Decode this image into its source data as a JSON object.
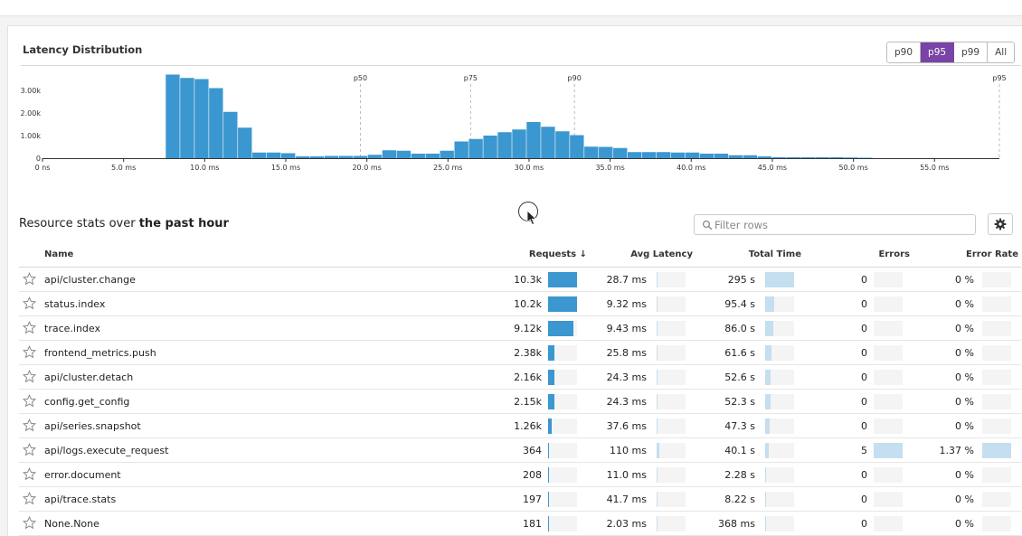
{
  "distribution": {
    "title": "Latency Distribution",
    "percentile_buttons": [
      {
        "label": "p90",
        "active": false
      },
      {
        "label": "p95",
        "active": true
      },
      {
        "label": "p99",
        "active": false
      },
      {
        "label": "All",
        "active": false
      }
    ]
  },
  "chart_data": {
    "type": "bar",
    "bin_width_ms": 0.89,
    "x": [
      7.6,
      8.5,
      9.4,
      10.3,
      11.2,
      12.1,
      13.0,
      13.9,
      14.8,
      15.7,
      16.6,
      17.5,
      18.4,
      19.3,
      20.2,
      21.1,
      22.0,
      22.9,
      23.8,
      24.7,
      25.6,
      26.5,
      27.4,
      28.3,
      29.2,
      30.1,
      31.0,
      31.9,
      32.8,
      33.7,
      34.6,
      35.5,
      36.4,
      37.3,
      38.2,
      39.1,
      40.0
    ],
    "values": [
      3700,
      3550,
      3500,
      3100,
      2050,
      1350,
      250,
      250,
      220,
      80,
      80,
      100,
      100,
      100,
      150,
      350,
      330,
      200,
      200,
      330,
      740,
      850,
      1000,
      1150,
      1270,
      1600,
      1390,
      1190,
      1020,
      510,
      500,
      450,
      270,
      270,
      270,
      250,
      250,
      200,
      200,
      130,
      130,
      80,
      40,
      40,
      40,
      40,
      40,
      30,
      20
    ],
    "xlabel": "",
    "ylabel": "",
    "xlim": [
      0,
      59
    ],
    "ylim": [
      0,
      4000
    ],
    "x_ticks": [
      "0 ns",
      "5.0 ms",
      "10.0 ms",
      "15.0 ms",
      "20.0 ms",
      "25.0 ms",
      "30.0 ms",
      "35.0 ms",
      "40.0 ms",
      "45.0 ms",
      "50.0 ms",
      "55.0 ms"
    ],
    "y_ticks": [
      "0",
      "1.00k",
      "2.00k",
      "3.00k"
    ],
    "markers": [
      {
        "label": "p50",
        "x": 19.6
      },
      {
        "label": "p75",
        "x": 26.4
      },
      {
        "label": "p90",
        "x": 32.8
      },
      {
        "label": "p95",
        "x": 59.0
      }
    ],
    "bar_color": "#3b97cf",
    "grid": false
  },
  "stats": {
    "title_prefix": "Resource stats over ",
    "title_emphasis": "the past hour",
    "filter_placeholder": "Filter rows",
    "columns": {
      "name": "Name",
      "requests": "Requests ↓",
      "avg_latency": "Avg Latency",
      "total_time": "Total Time",
      "errors": "Errors",
      "error_rate": "Error Rate"
    },
    "rows": [
      {
        "name": "api/cluster.change",
        "requests": "10.3k",
        "req_frac": 1.0,
        "avg_latency": "28.7 ms",
        "lat_frac": 0.02,
        "total_time": "295 s",
        "time_frac": 1.0,
        "errors": "0",
        "err_frac": 0,
        "error_rate": "0 %",
        "rate_frac": 0
      },
      {
        "name": "status.index",
        "requests": "10.2k",
        "req_frac": 0.99,
        "avg_latency": "9.32 ms",
        "lat_frac": 0.01,
        "total_time": "95.4 s",
        "time_frac": 0.32,
        "errors": "0",
        "err_frac": 0,
        "error_rate": "0 %",
        "rate_frac": 0
      },
      {
        "name": "trace.index",
        "requests": "9.12k",
        "req_frac": 0.89,
        "avg_latency": "9.43 ms",
        "lat_frac": 0.01,
        "total_time": "86.0 s",
        "time_frac": 0.29,
        "errors": "0",
        "err_frac": 0,
        "error_rate": "0 %",
        "rate_frac": 0
      },
      {
        "name": "frontend_metrics.push",
        "requests": "2.38k",
        "req_frac": 0.23,
        "avg_latency": "25.8 ms",
        "lat_frac": 0.02,
        "total_time": "61.6 s",
        "time_frac": 0.21,
        "errors": "0",
        "err_frac": 0,
        "error_rate": "0 %",
        "rate_frac": 0
      },
      {
        "name": "api/cluster.detach",
        "requests": "2.16k",
        "req_frac": 0.21,
        "avg_latency": "24.3 ms",
        "lat_frac": 0.02,
        "total_time": "52.6 s",
        "time_frac": 0.18,
        "errors": "0",
        "err_frac": 0,
        "error_rate": "0 %",
        "rate_frac": 0
      },
      {
        "name": "config.get_config",
        "requests": "2.15k",
        "req_frac": 0.21,
        "avg_latency": "24.3 ms",
        "lat_frac": 0.02,
        "total_time": "52.3 s",
        "time_frac": 0.18,
        "errors": "0",
        "err_frac": 0,
        "error_rate": "0 %",
        "rate_frac": 0
      },
      {
        "name": "api/series.snapshot",
        "requests": "1.26k",
        "req_frac": 0.12,
        "avg_latency": "37.6 ms",
        "lat_frac": 0.03,
        "total_time": "47.3 s",
        "time_frac": 0.16,
        "errors": "0",
        "err_frac": 0,
        "error_rate": "0 %",
        "rate_frac": 0
      },
      {
        "name": "api/logs.execute_request",
        "requests": "364",
        "req_frac": 0.035,
        "avg_latency": "110 ms",
        "lat_frac": 0.09,
        "total_time": "40.1 s",
        "time_frac": 0.14,
        "errors": "5",
        "err_frac": 1.0,
        "error_rate": "1.37 %",
        "rate_frac": 1.0
      },
      {
        "name": "error.document",
        "requests": "208",
        "req_frac": 0.02,
        "avg_latency": "11.0 ms",
        "lat_frac": 0.01,
        "total_time": "2.28 s",
        "time_frac": 0.008,
        "errors": "0",
        "err_frac": 0,
        "error_rate": "0 %",
        "rate_frac": 0
      },
      {
        "name": "api/trace.stats",
        "requests": "197",
        "req_frac": 0.019,
        "avg_latency": "41.7 ms",
        "lat_frac": 0.03,
        "total_time": "8.22 s",
        "time_frac": 0.028,
        "errors": "0",
        "err_frac": 0,
        "error_rate": "0 %",
        "rate_frac": 0
      },
      {
        "name": "None.None",
        "requests": "181",
        "req_frac": 0.018,
        "avg_latency": "2.03 ms",
        "lat_frac": 0.002,
        "total_time": "368 ms",
        "time_frac": 0.001,
        "errors": "0",
        "err_frac": 0,
        "error_rate": "0 %",
        "rate_frac": 0
      }
    ]
  },
  "icons": {
    "star": "star-outline-icon",
    "search": "search-icon",
    "settings": "gear-icon"
  }
}
